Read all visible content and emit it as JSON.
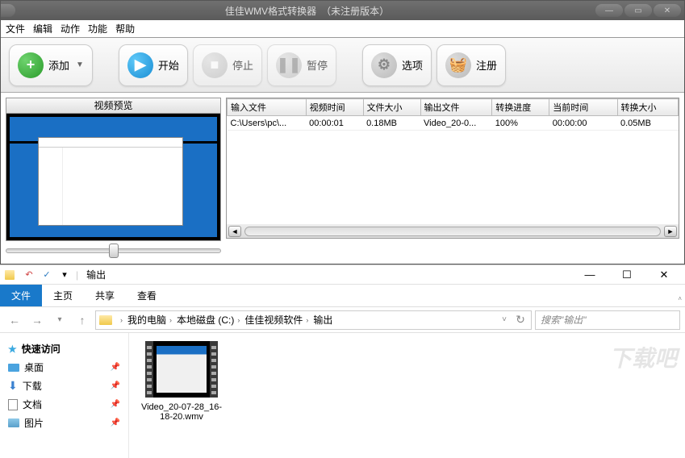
{
  "app": {
    "title": "佳佳WMV格式转换器　（未注册版本）",
    "menus": [
      "文件",
      "编辑",
      "动作",
      "功能",
      "帮助"
    ],
    "toolbar": {
      "add": "添加",
      "start": "开始",
      "stop": "停止",
      "pause": "暂停",
      "options": "选项",
      "register": "注册"
    },
    "preview_title": "视频预览",
    "table": {
      "headers": [
        "输入文件",
        "视频时间",
        "文件大小",
        "输出文件",
        "转换进度",
        "当前时间",
        "转换大小"
      ],
      "rows": [
        [
          "C:\\Users\\pc\\...",
          "00:00:01",
          "0.18MB",
          "Video_20-0...",
          "100%",
          "00:00:00",
          "0.05MB"
        ]
      ]
    }
  },
  "explorer": {
    "title": "输出",
    "tabs": [
      "文件",
      "主页",
      "共享",
      "查看"
    ],
    "breadcrumb": [
      "我的电脑",
      "本地磁盘 (C:)",
      "佳佳视频软件",
      "输出"
    ],
    "search_placeholder": "搜索\"输出\"",
    "sidebar": {
      "quick_access": "快速访问",
      "items": [
        "桌面",
        "下载",
        "文档",
        "图片"
      ]
    },
    "file": {
      "name": "Video_20-07-28_16-18-20.wmv"
    }
  },
  "watermark": "下载吧"
}
